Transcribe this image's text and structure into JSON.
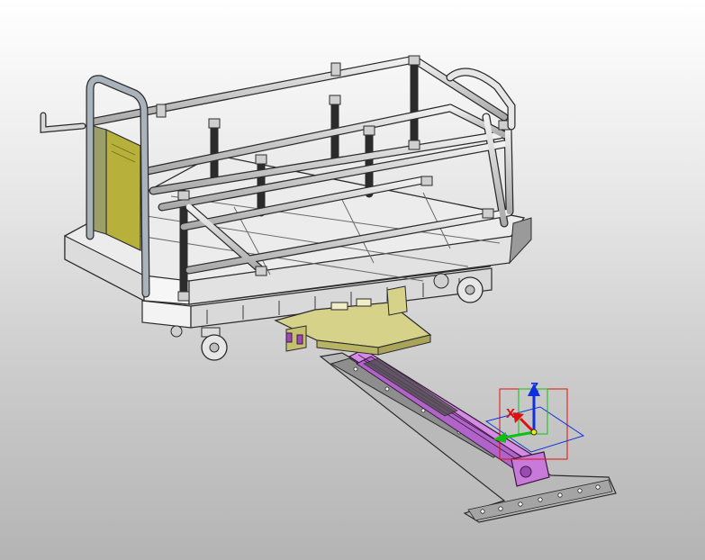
{
  "viewport": {
    "background_top": "#ffffff",
    "background_bottom": "#b4b4b4"
  },
  "colors": {
    "tube": "#c8c8c8",
    "tube_edge": "#2b2b2b",
    "frame": "#e2e2e2",
    "plate_yellow": "#d6d28a",
    "panel_olive": "#b7b13c",
    "actuator_magenta": "#c77ad9",
    "axis_x": "#e01010",
    "axis_y": "#10c010",
    "axis_z": "#1030e0"
  },
  "triad": {
    "x_label": "X",
    "z_label": "Z"
  }
}
